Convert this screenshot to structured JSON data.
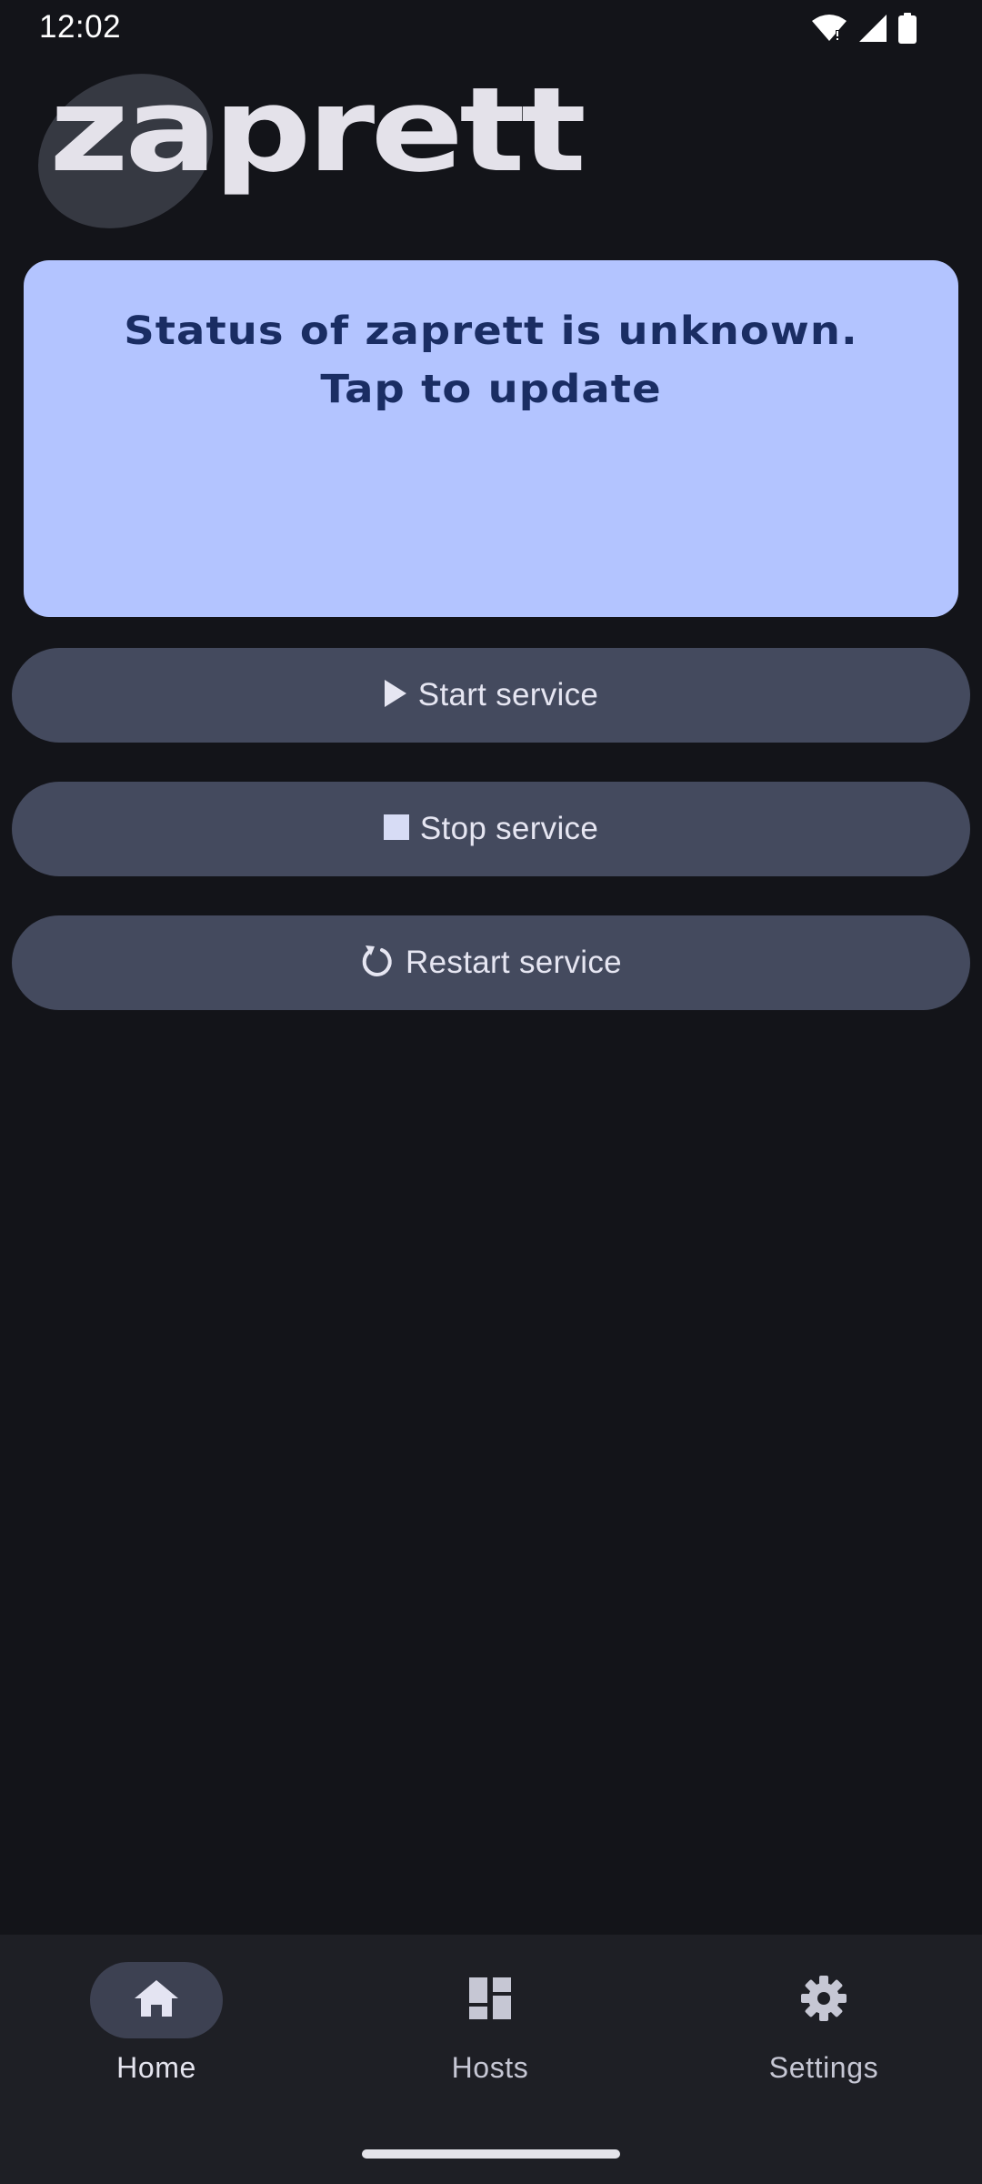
{
  "status_bar": {
    "time": "12:02",
    "icons": [
      "wifi-icon",
      "signal-icon",
      "battery-icon"
    ]
  },
  "app": {
    "logo_text": "zaprett"
  },
  "status_card": {
    "text": "Status of zaprett is unknown.\nTap to update"
  },
  "actions": {
    "start": {
      "label": "Start service",
      "icon": "play-icon"
    },
    "stop": {
      "label": "Stop service",
      "icon": "stop-icon"
    },
    "restart": {
      "label": "Restart service",
      "icon": "restart-icon"
    }
  },
  "nav": {
    "items": [
      {
        "label": "Home",
        "icon": "home-icon",
        "active": true
      },
      {
        "label": "Hosts",
        "icon": "dashboard-icon",
        "active": false
      },
      {
        "label": "Settings",
        "icon": "gear-icon",
        "active": false
      }
    ]
  },
  "colors": {
    "background": "#131419",
    "card": "#b3c4ff",
    "card_text": "#1a2d63",
    "button": "#444a5e",
    "nav_background": "#1e1f25",
    "nav_active_pill": "#3d4152"
  }
}
